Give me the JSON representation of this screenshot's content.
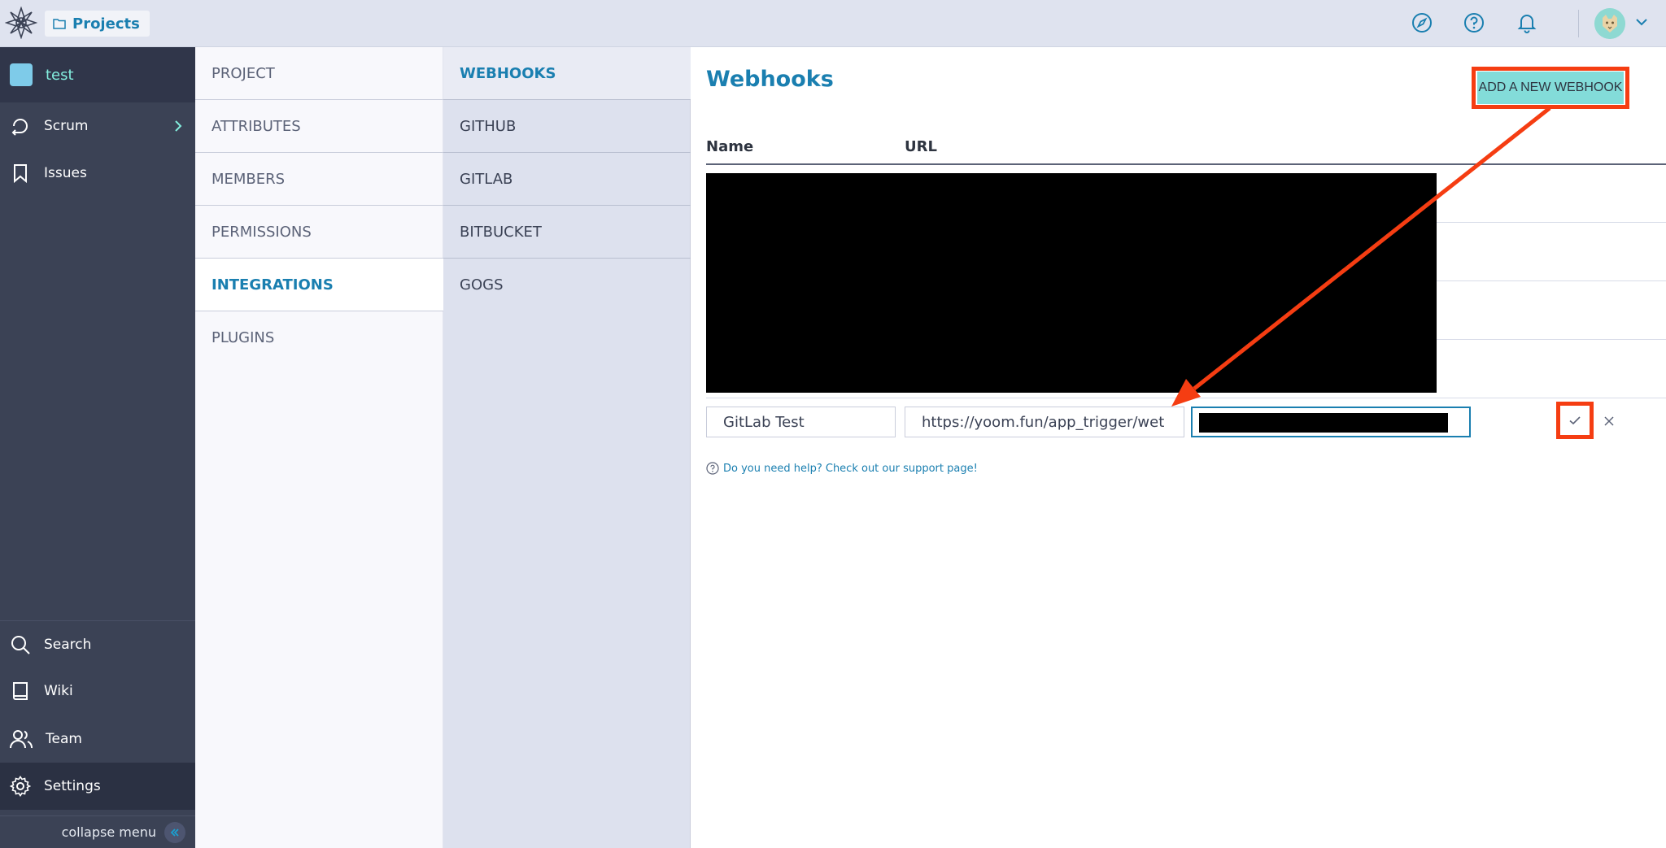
{
  "topbar": {
    "projects_label": "Projects"
  },
  "leftnav": {
    "project_name": "test",
    "items": [
      {
        "label": "Scrum",
        "icon": "scrum-icon"
      },
      {
        "label": "Issues",
        "icon": "bookmark-icon"
      }
    ],
    "bottom_items": [
      {
        "label": "Search",
        "icon": "search-icon"
      },
      {
        "label": "Wiki",
        "icon": "book-icon"
      },
      {
        "label": "Team",
        "icon": "team-icon"
      },
      {
        "label": "Settings",
        "icon": "gear-icon"
      }
    ],
    "collapse_label": "collapse menu"
  },
  "settings_menu": {
    "items": [
      "PROJECT",
      "ATTRIBUTES",
      "MEMBERS",
      "PERMISSIONS",
      "INTEGRATIONS",
      "PLUGINS"
    ],
    "active": "INTEGRATIONS"
  },
  "integrations_menu": {
    "items": [
      "WEBHOOKS",
      "GITHUB",
      "GITLAB",
      "BITBUCKET",
      "GOGS"
    ],
    "active": "WEBHOOKS"
  },
  "main": {
    "title": "Webhooks",
    "add_button_label": "ADD A NEW WEBHOOK",
    "columns": {
      "name": "Name",
      "url": "URL"
    },
    "new_webhook": {
      "name_value": "GitLab Test",
      "url_value": "https://yoom.fun/app_trigger/wet"
    },
    "help_text": "Do you need help? Check out our support page!"
  },
  "colors": {
    "accent": "#1a7fb0",
    "highlight": "#f53d12",
    "button_bg": "#83dcd9",
    "nav_bg": "#3b4255"
  }
}
